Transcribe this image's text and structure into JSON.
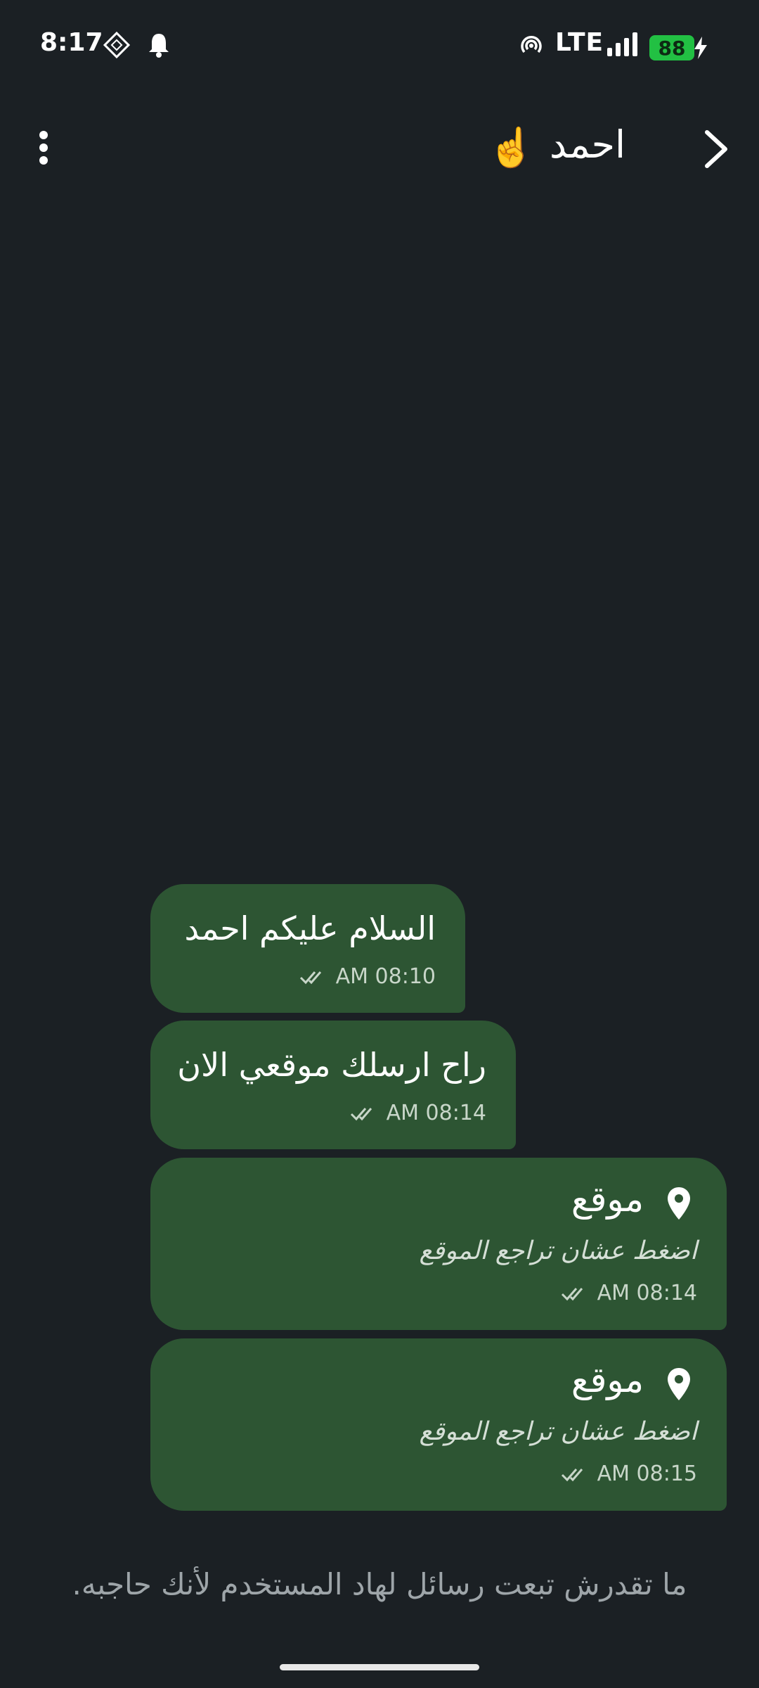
{
  "status_bar": {
    "time": "8:17",
    "network": "LTE",
    "battery": "88",
    "icons": [
      "navigation-icon",
      "notification-bell-icon",
      "hotspot-icon",
      "signal-icon",
      "charging-icon"
    ]
  },
  "header": {
    "contact_name": "احمد",
    "contact_emoji": "☝️",
    "icons": [
      "more-options-icon",
      "back-chevron-icon"
    ]
  },
  "messages": [
    {
      "type": "text",
      "text": "السلام عليكم احمد",
      "time": "AM 08:10",
      "status": "read"
    },
    {
      "type": "text",
      "text": "راح ارسلك موقعي الان",
      "time": "AM 08:14",
      "status": "read"
    },
    {
      "type": "location",
      "title": "موقع",
      "subtitle": "اضغط عشان تراجع الموقع",
      "time": "AM 08:14",
      "status": "read"
    },
    {
      "type": "location",
      "title": "موقع",
      "subtitle": "اضغط عشان تراجع الموقع",
      "time": "AM 08:15",
      "status": "read"
    }
  ],
  "blocked_notice": "ما تقدرش تبعت رسائل لهاد المستخدم لأنك حاجبه.",
  "colors": {
    "background": "#1b2024",
    "bubble": "#2d5533",
    "battery": "#22c043",
    "muted_text": "#9ea5a9"
  }
}
